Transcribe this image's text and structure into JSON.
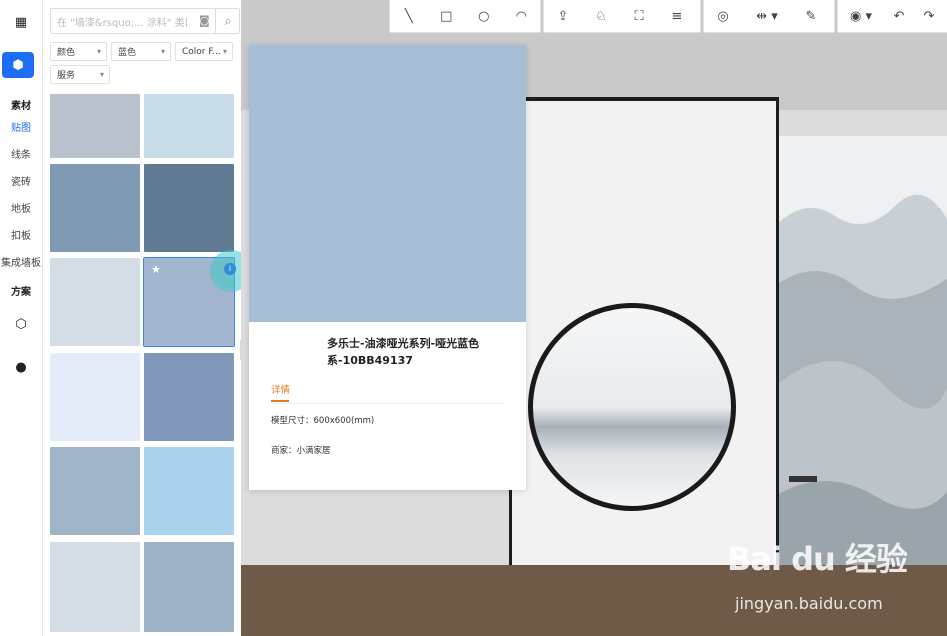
{
  "rail": {
    "top_icon": "grid-icon",
    "active_icon": "cube-icon",
    "items": [
      {
        "label": "素材",
        "style": "bold"
      },
      {
        "label": "贴图",
        "style": "active"
      },
      {
        "label": "线条",
        "style": "normal"
      },
      {
        "label": "瓷砖",
        "style": "normal"
      },
      {
        "label": "地板",
        "style": "normal"
      },
      {
        "label": "扣板",
        "style": "normal"
      },
      {
        "label": "集成墙板",
        "style": "normal"
      },
      {
        "label": "方案",
        "style": "bold"
      }
    ],
    "bottom_icons": [
      "hexagon-icon",
      "user-icon"
    ]
  },
  "search": {
    "placeholder": "在 \"墙漆&rsquo;... 涂料\" 类目下搜",
    "camera_icon": "camera-icon",
    "search_icon": "search-icon"
  },
  "filters": [
    {
      "label": "颜色"
    },
    {
      "label": "蓝色"
    },
    {
      "label": "Color F..."
    },
    {
      "label": "服务"
    }
  ],
  "swatches": [
    "#b7c2cc",
    "#c9dcea",
    "#7f9ab3",
    "#5f7a92",
    "#d2dde6",
    "#a3b6d0",
    "#e3ecf8",
    "#8198ba",
    "#a0b4c7",
    "#abd3ee",
    "#d4dde6",
    "#9fb3c8"
  ],
  "selected_swatch_index": 5,
  "toolbar": {
    "group1": [
      "line-icon",
      "rectangle-icon",
      "circle-icon",
      "arc-icon"
    ],
    "group2": [
      "push-pull-icon",
      "offset-icon",
      "frame-icon",
      "grid-lines-icon"
    ],
    "group3": [
      "measure-icon",
      "align-icon",
      "paint-icon"
    ],
    "group4": [
      "eye-icon",
      "undo-icon",
      "redo-icon"
    ]
  },
  "card": {
    "swatch_color": "#a6bfd6",
    "title": "多乐士-油漆哑光系列-哑光蓝色系-10BB49137",
    "tab": "详情",
    "size_label": "模型尺寸：600x600(mm)",
    "vendor_label": "商家：小满家居"
  },
  "watermark": {
    "brand": "Bai du 经验",
    "url": "jingyan.baidu.com"
  }
}
